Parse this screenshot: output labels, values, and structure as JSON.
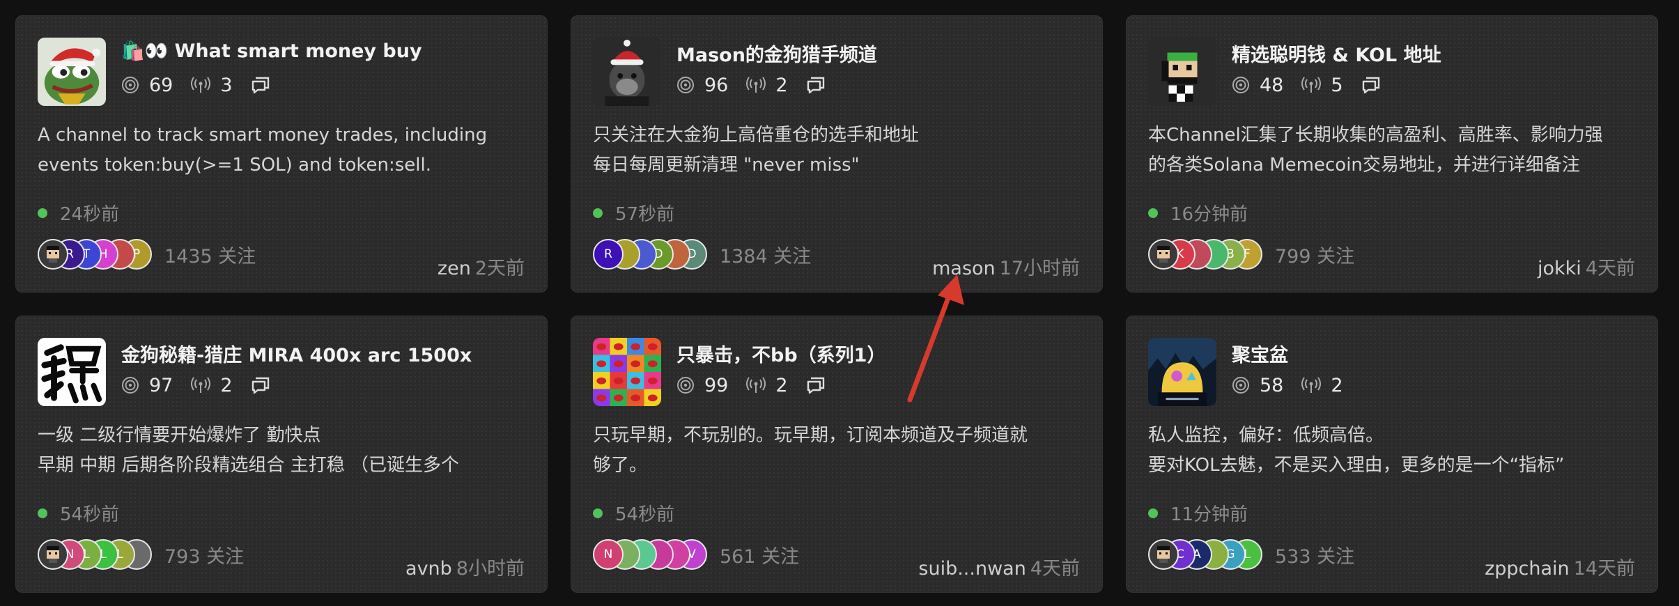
{
  "colors": {
    "background": "#111111",
    "card": "#2b2b2b",
    "online_dot": "#52c25a",
    "annotation_arrow": "#d63a2c"
  },
  "cards": [
    {
      "title": "🛍️👀 What smart money buy",
      "avatar": "pepe-santa-hat",
      "stats": {
        "subscribers": "69",
        "signals": "3"
      },
      "description": "A channel to track smart money trades, including\nevents token:buy(>=1 SOL) and token:sell.",
      "activity": "24秒前",
      "members": [
        {
          "letter": "",
          "color": "#3a3a3a",
          "pixel": true
        },
        {
          "letter": "R",
          "color": "#3a1a8f"
        },
        {
          "letter": "T",
          "color": "#3c46d6"
        },
        {
          "letter": "H",
          "color": "#d640d0"
        },
        {
          "letter": "",
          "color": "#c44a4a"
        },
        {
          "letter": "P",
          "color": "#b09a2a"
        }
      ],
      "followers": "1435 关注",
      "owner": "zen",
      "time": "2天前"
    },
    {
      "title": "Mason的金狗猎手频道",
      "avatar": "ape-santa-hat",
      "stats": {
        "subscribers": "96",
        "signals": "2"
      },
      "description": "只关注在大金狗上高倍重仓的选手和地址\n每日每周更新清理  \"never miss\"",
      "activity": "57秒前",
      "members": [
        {
          "letter": "R",
          "color": "#3d10b8"
        },
        {
          "letter": "",
          "color": "#a8a02a"
        },
        {
          "letter": "",
          "color": "#4a5ad0"
        },
        {
          "letter": "D",
          "color": "#6a9a2a"
        },
        {
          "letter": "",
          "color": "#c0643c"
        },
        {
          "letter": "D",
          "color": "#5a8a78"
        }
      ],
      "followers": "1384 关注",
      "owner": "mason",
      "time": "17小时前"
    },
    {
      "title": "精选聪明钱 & KOL 地址",
      "avatar": "pixel-character",
      "stats": {
        "subscribers": "48",
        "signals": "5"
      },
      "description": "本Channel汇集了长期收集的高盈利、高胜率、影响力强\n的各类Solana Memecoin交易地址，并进行详细备注",
      "activity": "16分钟前",
      "members": [
        {
          "letter": "",
          "color": "#3a3a3a",
          "pixel": true
        },
        {
          "letter": "K",
          "color": "#d83a4a"
        },
        {
          "letter": "",
          "color": "#c04a5a"
        },
        {
          "letter": "",
          "color": "#4ab86a"
        },
        {
          "letter": "B",
          "color": "#8ab04a"
        },
        {
          "letter": "F",
          "color": "#c0a030"
        }
      ],
      "followers": "799 关注",
      "owner": "jokki",
      "time": "4天前"
    },
    {
      "title": "金狗秘籍-猎庄 MIRA 400x arc 1500x",
      "avatar": "calligraphy-稳",
      "stats": {
        "subscribers": "97",
        "signals": "2"
      },
      "description": "一级 二级行情要开始爆炸了 勤快点\n早期 中期  后期各阶段精选组合 主打稳    （已诞生多个",
      "activity": "54秒前",
      "members": [
        {
          "letter": "",
          "color": "#3a3a3a",
          "pixel": true
        },
        {
          "letter": "N",
          "color": "#d04a7a"
        },
        {
          "letter": "L",
          "color": "#7ab040"
        },
        {
          "letter": "L",
          "color": "#3cc040"
        },
        {
          "letter": "L",
          "color": "#9aa83a"
        },
        {
          "letter": "",
          "color": "#6a6a6a"
        }
      ],
      "followers": "793 关注",
      "owner": "avnb",
      "time": "8小时前"
    },
    {
      "title": "只暴击，不bb（系列1）",
      "avatar": "pop-art-tongues",
      "stats": {
        "subscribers": "99",
        "signals": "2"
      },
      "description": "只玩早期，不玩别的。玩早期，订阅本频道及子频道就\n够了。",
      "activity": "54秒前",
      "members": [
        {
          "letter": "N",
          "color": "#d04070"
        },
        {
          "letter": "",
          "color": "#7ab060"
        },
        {
          "letter": "",
          "color": "#5ac890"
        },
        {
          "letter": "",
          "color": "#c83a9a"
        },
        {
          "letter": "",
          "color": "#d040a0"
        },
        {
          "letter": "V",
          "color": "#c040d0"
        }
      ],
      "followers": "561 关注",
      "owner": "suib...nwan",
      "time": "4天前"
    },
    {
      "title": "聚宝盆",
      "avatar": "dome-night-sky",
      "stats": {
        "subscribers": "58",
        "signals": "2"
      },
      "description": "私人监控，偏好：低频高倍。\n要对KOL去魅，不是买入理由，更多的是一个“指标”",
      "activity": "11分钟前",
      "members": [
        {
          "letter": "",
          "color": "#3a3a3a",
          "pixel": true
        },
        {
          "letter": "C",
          "color": "#7030d0"
        },
        {
          "letter": "A",
          "color": "#1a2a6a"
        },
        {
          "letter": "",
          "color": "#8ab040"
        },
        {
          "letter": "G",
          "color": "#3aa0c0"
        },
        {
          "letter": "L",
          "color": "#4ac040"
        }
      ],
      "followers": "533 关注",
      "owner": "zppchain",
      "time": "14天前"
    }
  ]
}
